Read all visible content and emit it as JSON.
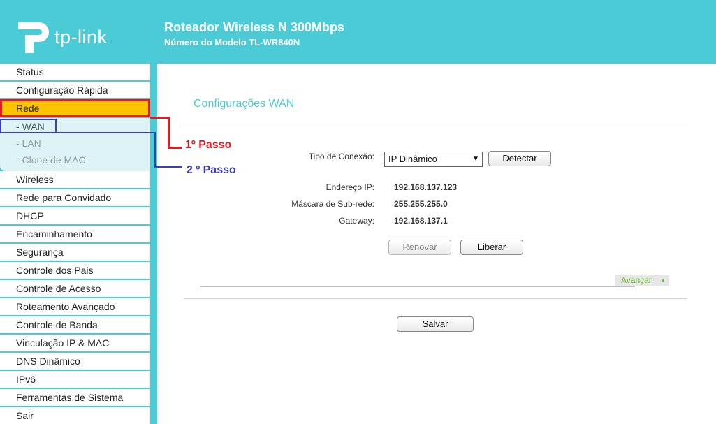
{
  "header": {
    "logo_text": "tp-link",
    "title": "Roteador Wireless N 300Mbps",
    "model": "Número do Modelo TL-WR840N"
  },
  "sidebar": {
    "items_top": [
      "Status",
      "Configuração Rápida",
      "Rede"
    ],
    "subitems": [
      "- WAN",
      "- LAN",
      "- Clone de MAC"
    ],
    "items_bottom": [
      "Wireless",
      "Rede para Convidado",
      "DHCP",
      "Encaminhamento",
      "Segurança",
      "Controle dos Pais",
      "Controle de Acesso",
      "Roteamento Avançado",
      "Controle de Banda",
      "Vinculação IP & MAC",
      "DNS Dinâmico",
      "IPv6",
      "Ferramentas de Sistema",
      "Sair"
    ]
  },
  "annotations": {
    "step1": "1º Passo",
    "step2": "2 º Passo",
    "colors": {
      "step1": "#e01b22",
      "step2": "#3b3eb4"
    }
  },
  "main": {
    "title": "Configurações WAN",
    "connection_type_label": "Tipo de Conexão:",
    "connection_type_value": "IP Dinâmico",
    "detect_button": "Detectar",
    "ip_label": "Endereço IP:",
    "ip_value": "192.168.137.123",
    "mask_label": "Máscara de Sub-rede:",
    "mask_value": "255.255.255.0",
    "gateway_label": "Gateway:",
    "gateway_value": "192.168.137.1",
    "renew_button": "Renovar",
    "release_button": "Liberar",
    "advanced_link": "Avançar",
    "save_button": "Salvar"
  },
  "theme": {
    "accent": "#4bcbd6",
    "active_menu": "#ffc400",
    "advanced_green": "#6ebe2f"
  }
}
